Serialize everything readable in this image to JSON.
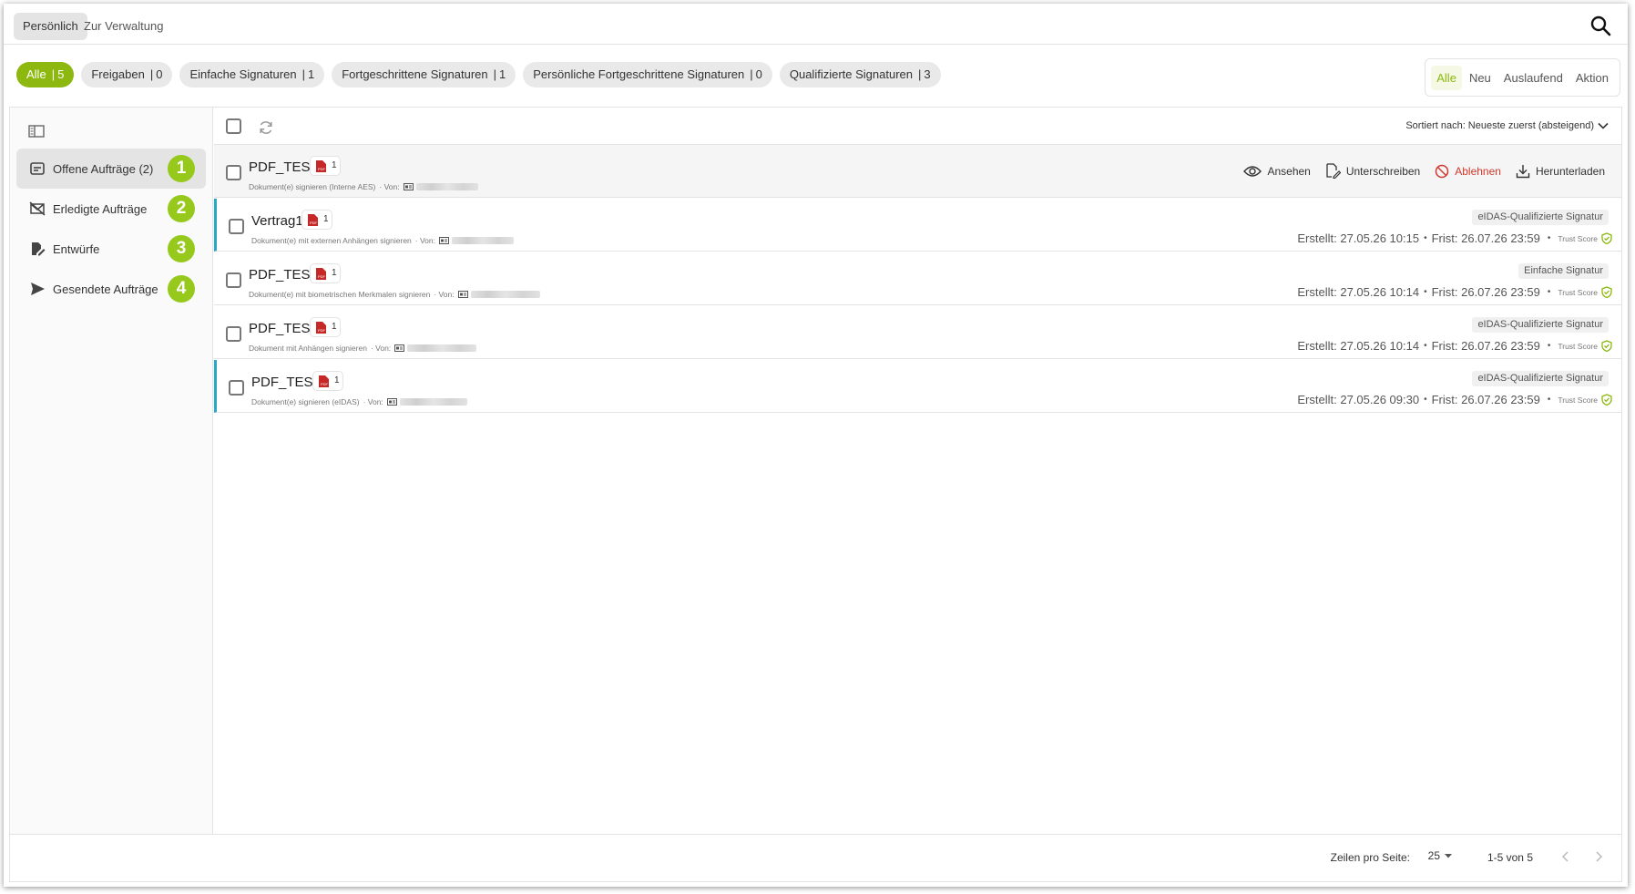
{
  "top_tabs": [
    "Persönlich",
    "Zur Verwaltung"
  ],
  "filters": [
    {
      "label": "Alle",
      "count": "5",
      "active": true
    },
    {
      "label": "Freigaben",
      "count": "0"
    },
    {
      "label": "Einfache Signaturen",
      "count": "1"
    },
    {
      "label": "Fortgeschrittene Signaturen",
      "count": "1"
    },
    {
      "label": "Persönliche Fortgeschrittene Signaturen",
      "count": "0"
    },
    {
      "label": "Qualifizierte Signaturen",
      "count": "3"
    }
  ],
  "status_tabs": [
    "Alle",
    "Neu",
    "Auslaufend",
    "Aktion"
  ],
  "sidebar": {
    "items": [
      {
        "label": "Offene Aufträge (2)",
        "num": "1",
        "icon": "inbox-icon"
      },
      {
        "label": "Erledigte Aufträge",
        "num": "2",
        "icon": "done-mail-icon"
      },
      {
        "label": "Entwürfe",
        "num": "3",
        "icon": "draft-icon"
      },
      {
        "label": "Gesendete Aufträge",
        "num": "4",
        "icon": "send-icon"
      }
    ]
  },
  "list": {
    "sort_label": "Sortiert nach: Neueste zuerst (absteigend)",
    "actions": {
      "view": "Ansehen",
      "sign": "Unterschreiben",
      "reject": "Ablehnen",
      "download": "Herunterladen"
    },
    "rows": [
      {
        "title": "PDF_TEST",
        "doc_count": "1",
        "desc": "Dokument(e) signieren (Interne AES)",
        "from": "· Von:"
      },
      {
        "title": "Vertrag1",
        "doc_count": "1",
        "desc": "Dokument(e) mit externen Anhängen signieren",
        "from": "· Von:",
        "signature": "eIDAS-Qualifizierte Signatur",
        "created": "Erstellt: 27.05.26 10:15",
        "deadline": "Frist: 26.07.26 23:59",
        "trust": "Trust Score"
      },
      {
        "title": "PDF_TEST",
        "doc_count": "1",
        "desc": "Dokument(e) mit biometrischen Merkmalen signieren",
        "from": "· Von:",
        "signature": "Einfache Signatur",
        "created": "Erstellt: 27.05.26 10:14",
        "deadline": "Frist: 26.07.26 23:59",
        "trust": "Trust Score"
      },
      {
        "title": "PDF_TEST",
        "doc_count": "1",
        "desc": "Dokument mit Anhängen signieren",
        "from": "· Von:",
        "signature": "eIDAS-Qualifizierte Signatur",
        "created": "Erstellt: 27.05.26 10:14",
        "deadline": "Frist: 26.07.26 23:59",
        "trust": "Trust Score"
      },
      {
        "title": "PDF_TEST",
        "doc_count": "1",
        "desc": "Dokument(e) signieren (eIDAS)",
        "from": "· Von:",
        "signature": "eIDAS-Qualifizierte Signatur",
        "created": "Erstellt: 27.05.26 09:30",
        "deadline": "Frist: 26.07.26 23:59",
        "trust": "Trust Score"
      }
    ]
  },
  "footer": {
    "rows_per_page_label": "Zeilen pro Seite:",
    "rows_per_page": "25",
    "range": "1-5 von 5"
  },
  "colors": {
    "accent": "#8cb80f",
    "badge_green": "#97c91d",
    "reject_red": "#d0382d",
    "row_marker": "#2aa8c8",
    "pdf_red": "#c62828"
  }
}
